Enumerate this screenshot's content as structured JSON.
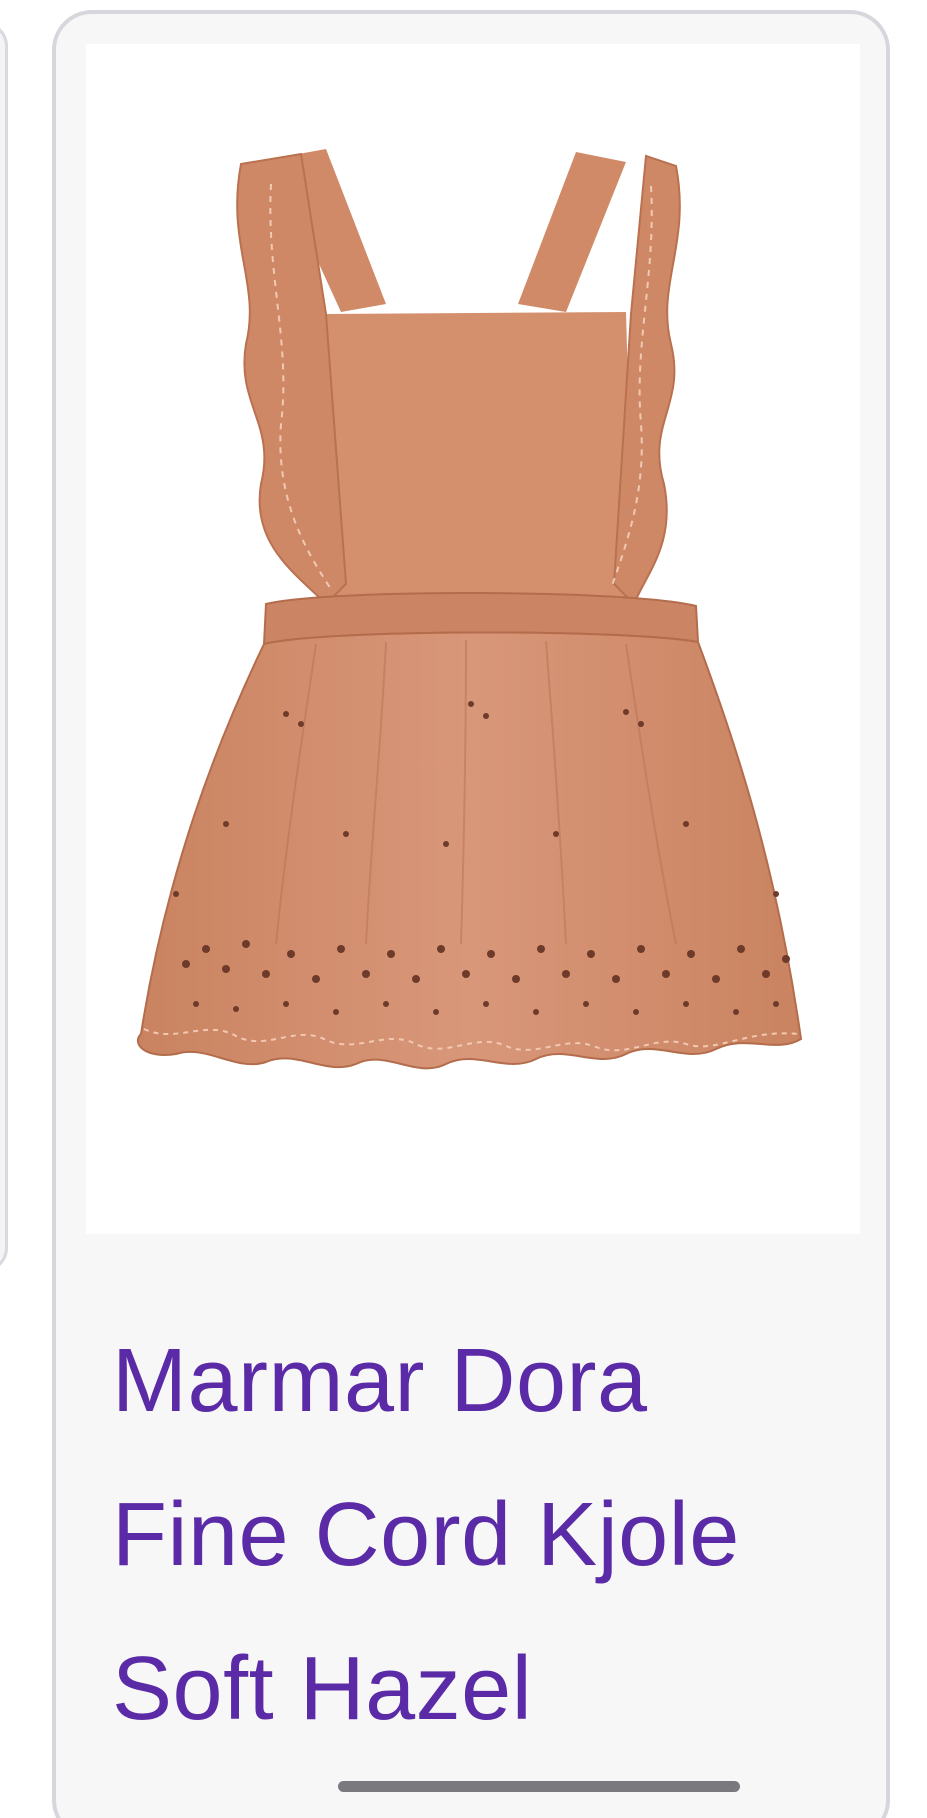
{
  "product_card": {
    "image_alt": "Marmar Dora Fine Cord Kjole Soft Hazel",
    "title_lines": [
      "Marmar Dora",
      "Fine Cord Kjole",
      "Soft Hazel"
    ]
  },
  "colors": {
    "title": "#5b2aa6",
    "card_background": "#f7f7f8",
    "card_border": "#d6d6dc",
    "dress": "#d4906d"
  },
  "icons": {
    "product_image": "dress-photo",
    "home_indicator": "gesture-bar"
  }
}
